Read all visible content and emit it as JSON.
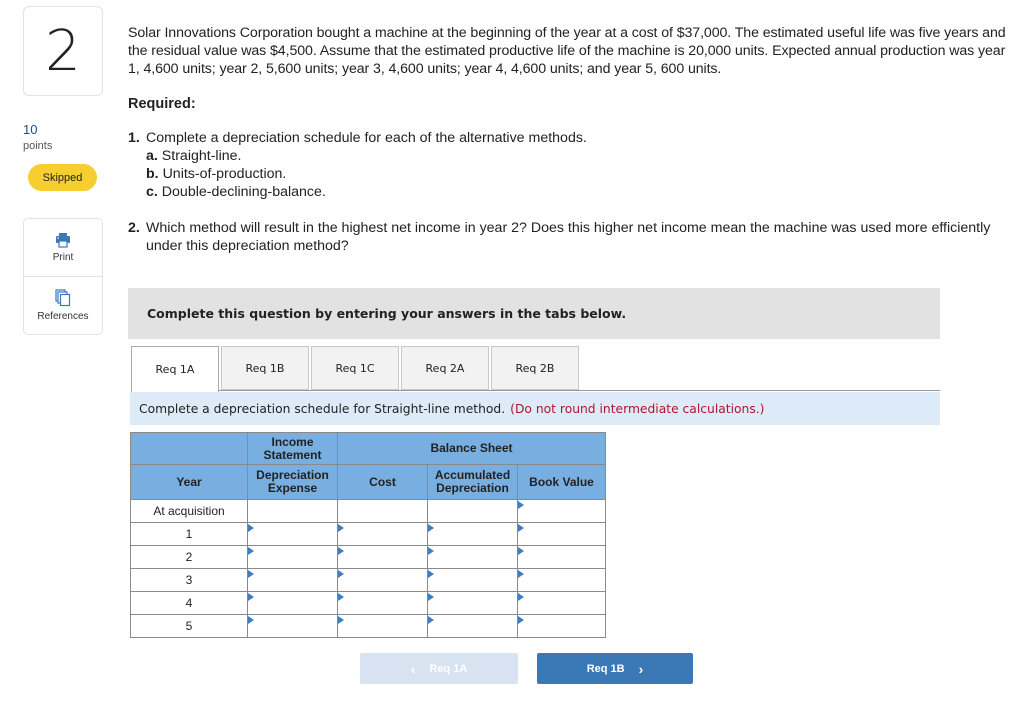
{
  "question": {
    "number": "2",
    "points_value": "10",
    "points_label": "points",
    "status": "Skipped",
    "status_color": "#f7ce2f",
    "text": "Solar Innovations Corporation bought a machine at the beginning of the year at a cost of $37,000. The estimated useful life was five years and the residual value was $4,500. Assume that the estimated productive life of the machine is 20,000 units. Expected annual production was year 1, 4,600 units; year 2, 5,600 units; year 3, 4,600 units; year 4, 4,600 units; and year 5, 600 units.",
    "required_label": "Required:",
    "requirements": [
      {
        "num": "1.",
        "text": "Complete a depreciation schedule for each of the alternative methods.",
        "subs": [
          {
            "letter": "a.",
            "text": "Straight-line."
          },
          {
            "letter": "b.",
            "text": "Units-of-production."
          },
          {
            "letter": "c.",
            "text": "Double-declining-balance."
          }
        ]
      },
      {
        "num": "2.",
        "text": "Which method will result in the highest net income in year 2? Does this higher net income mean the machine was used more efficiently under this depreciation method?"
      }
    ]
  },
  "tools": {
    "print_label": "Print",
    "print_icon": "printer-icon",
    "references_label": "References",
    "references_icon": "documents-icon"
  },
  "banner": "Complete this question by entering your answers in the tabs below.",
  "tabs": [
    {
      "label": "Req 1A",
      "active": true
    },
    {
      "label": "Req 1B",
      "active": false
    },
    {
      "label": "Req 1C",
      "active": false
    },
    {
      "label": "Req 2A",
      "active": false
    },
    {
      "label": "Req 2B",
      "active": false
    }
  ],
  "instruction": {
    "text": "Complete a depreciation schedule for Straight-line method.",
    "note": "(Do not round intermediate calculations.)",
    "note_color": "#b0162b"
  },
  "table": {
    "group_headers": {
      "income_statement": "Income Statement",
      "balance_sheet": "Balance Sheet"
    },
    "columns": {
      "year": "Year",
      "dep_expense": "Depreciation Expense",
      "cost": "Cost",
      "accum_dep": "Accumulated Depreciation",
      "book_value": "Book Value"
    },
    "header_color": "#78aee0",
    "rows": [
      {
        "year": "At acquisition",
        "dep_expense": "",
        "cost": "",
        "accum_dep": "",
        "book_value": ""
      },
      {
        "year": "1",
        "dep_expense": "",
        "cost": "",
        "accum_dep": "",
        "book_value": ""
      },
      {
        "year": "2",
        "dep_expense": "",
        "cost": "",
        "accum_dep": "",
        "book_value": ""
      },
      {
        "year": "3",
        "dep_expense": "",
        "cost": "",
        "accum_dep": "",
        "book_value": ""
      },
      {
        "year": "4",
        "dep_expense": "",
        "cost": "",
        "accum_dep": "",
        "book_value": ""
      },
      {
        "year": "5",
        "dep_expense": "",
        "cost": "",
        "accum_dep": "",
        "book_value": ""
      }
    ]
  },
  "nav": {
    "prev_label": "Req 1A",
    "prev_icon": "chevron-left-icon",
    "next_label": "Req 1B",
    "next_icon": "chevron-right-icon",
    "next_color": "#3a78b6"
  }
}
